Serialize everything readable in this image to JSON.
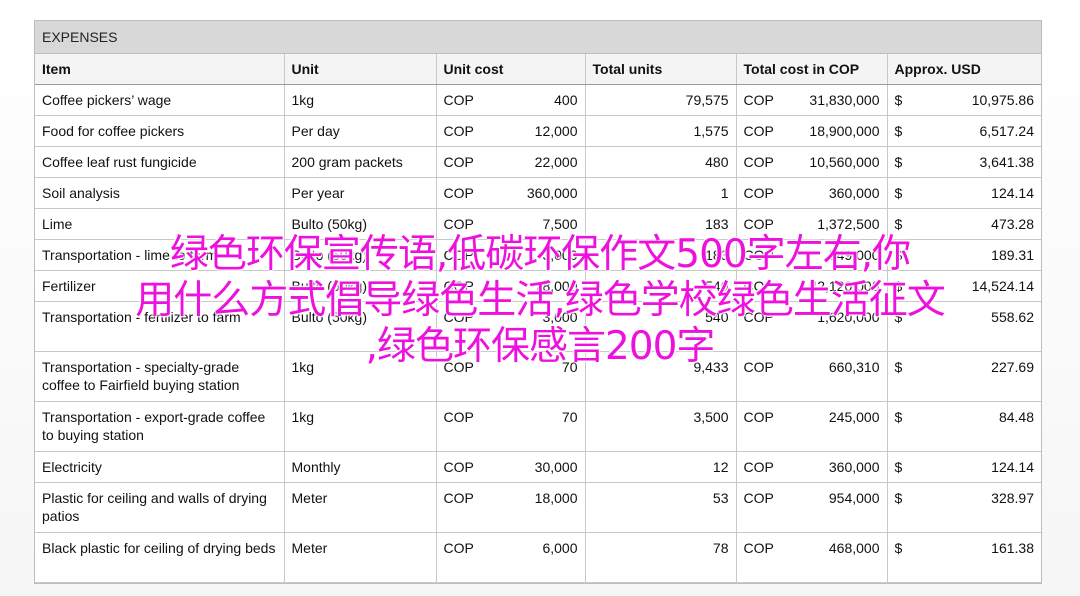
{
  "sheet_title": "EXPENSES",
  "headers": [
    "Item",
    "Unit",
    "Unit cost",
    "Total units",
    "Total cost in COP",
    "Approx. USD"
  ],
  "rows": [
    {
      "item": "Coffee pickers’ wage",
      "unit": "1kg",
      "ucur": "COP",
      "ucost": "400",
      "units": "79,575",
      "tcur": "COP",
      "tcost": "31,830,000",
      "usdcur": "$",
      "usd": "10,975.86",
      "tall": false
    },
    {
      "item": "Food for coffee pickers",
      "unit": "Per day",
      "ucur": "COP",
      "ucost": "12,000",
      "units": "1,575",
      "tcur": "COP",
      "tcost": "18,900,000",
      "usdcur": "$",
      "usd": "6,517.24",
      "tall": false
    },
    {
      "item": "Coffee leaf rust fungicide",
      "unit": "200 gram packets",
      "ucur": "COP",
      "ucost": "22,000",
      "units": "480",
      "tcur": "COP",
      "tcost": "10,560,000",
      "usdcur": "$",
      "usd": "3,641.38",
      "tall": false
    },
    {
      "item": "Soil analysis",
      "unit": "Per year",
      "ucur": "COP",
      "ucost": "360,000",
      "units": "1",
      "tcur": "COP",
      "tcost": "360,000",
      "usdcur": "$",
      "usd": "124.14",
      "tall": false
    },
    {
      "item": "Lime",
      "unit": "Bulto (50kg)",
      "ucur": "COP",
      "ucost": "7,500",
      "units": "183",
      "tcur": "COP",
      "tcost": "1,372,500",
      "usdcur": "$",
      "usd": "473.28",
      "tall": false
    },
    {
      "item": "Transportation - lime to farm",
      "unit": "Bulto (50kg)",
      "ucur": "COP",
      "ucost": "3,000",
      "units": "183",
      "tcur": "COP",
      "tcost": "549,000",
      "usdcur": "$",
      "usd": "189.31",
      "tall": false
    },
    {
      "item": "Fertilizer",
      "unit": "Bulto (50kg)",
      "ucur": "COP",
      "ucost": "78,000",
      "units": "540",
      "tcur": "COP",
      "tcost": "42,120,000",
      "usdcur": "$",
      "usd": "14,524.14",
      "tall": false
    },
    {
      "item": "Transportation - fertilizer to farm",
      "unit": "Bulto (50kg)",
      "ucur": "COP",
      "ucost": "3,000",
      "units": "540",
      "tcur": "COP",
      "tcost": "1,620,000",
      "usdcur": "$",
      "usd": "558.62",
      "tall": true
    },
    {
      "item": "Transportation - specialty-grade coffee to Fairfield buying station",
      "unit": "1kg",
      "ucur": "COP",
      "ucost": "70",
      "units": "9,433",
      "tcur": "COP",
      "tcost": "660,310",
      "usdcur": "$",
      "usd": "227.69",
      "tall": true
    },
    {
      "item": "Transportation - export-grade coffee to buying station",
      "unit": "1kg",
      "ucur": "COP",
      "ucost": "70",
      "units": "3,500",
      "tcur": "COP",
      "tcost": "245,000",
      "usdcur": "$",
      "usd": "84.48",
      "tall": true
    },
    {
      "item": "Electricity",
      "unit": "Monthly",
      "ucur": "COP",
      "ucost": "30,000",
      "units": "12",
      "tcur": "COP",
      "tcost": "360,000",
      "usdcur": "$",
      "usd": "124.14",
      "tall": false
    },
    {
      "item": "Plastic for ceiling and walls of drying patios",
      "unit": "Meter",
      "ucur": "COP",
      "ucost": "18,000",
      "units": "53",
      "tcur": "COP",
      "tcost": "954,000",
      "usdcur": "$",
      "usd": "328.97",
      "tall": true
    },
    {
      "item": "Black plastic for ceiling of drying beds",
      "unit": "Meter",
      "ucur": "COP",
      "ucost": "6,000",
      "units": "78",
      "tcur": "COP",
      "tcost": "468,000",
      "usdcur": "$",
      "usd": "161.38",
      "tall": true
    }
  ],
  "overlay_lines": [
    "绿色环保宣传语,低碳环保作文500字左右,你",
    "用什么方式倡导绿色生活,绿色学校绿色生活征文",
    ",绿色环保感言200字"
  ]
}
